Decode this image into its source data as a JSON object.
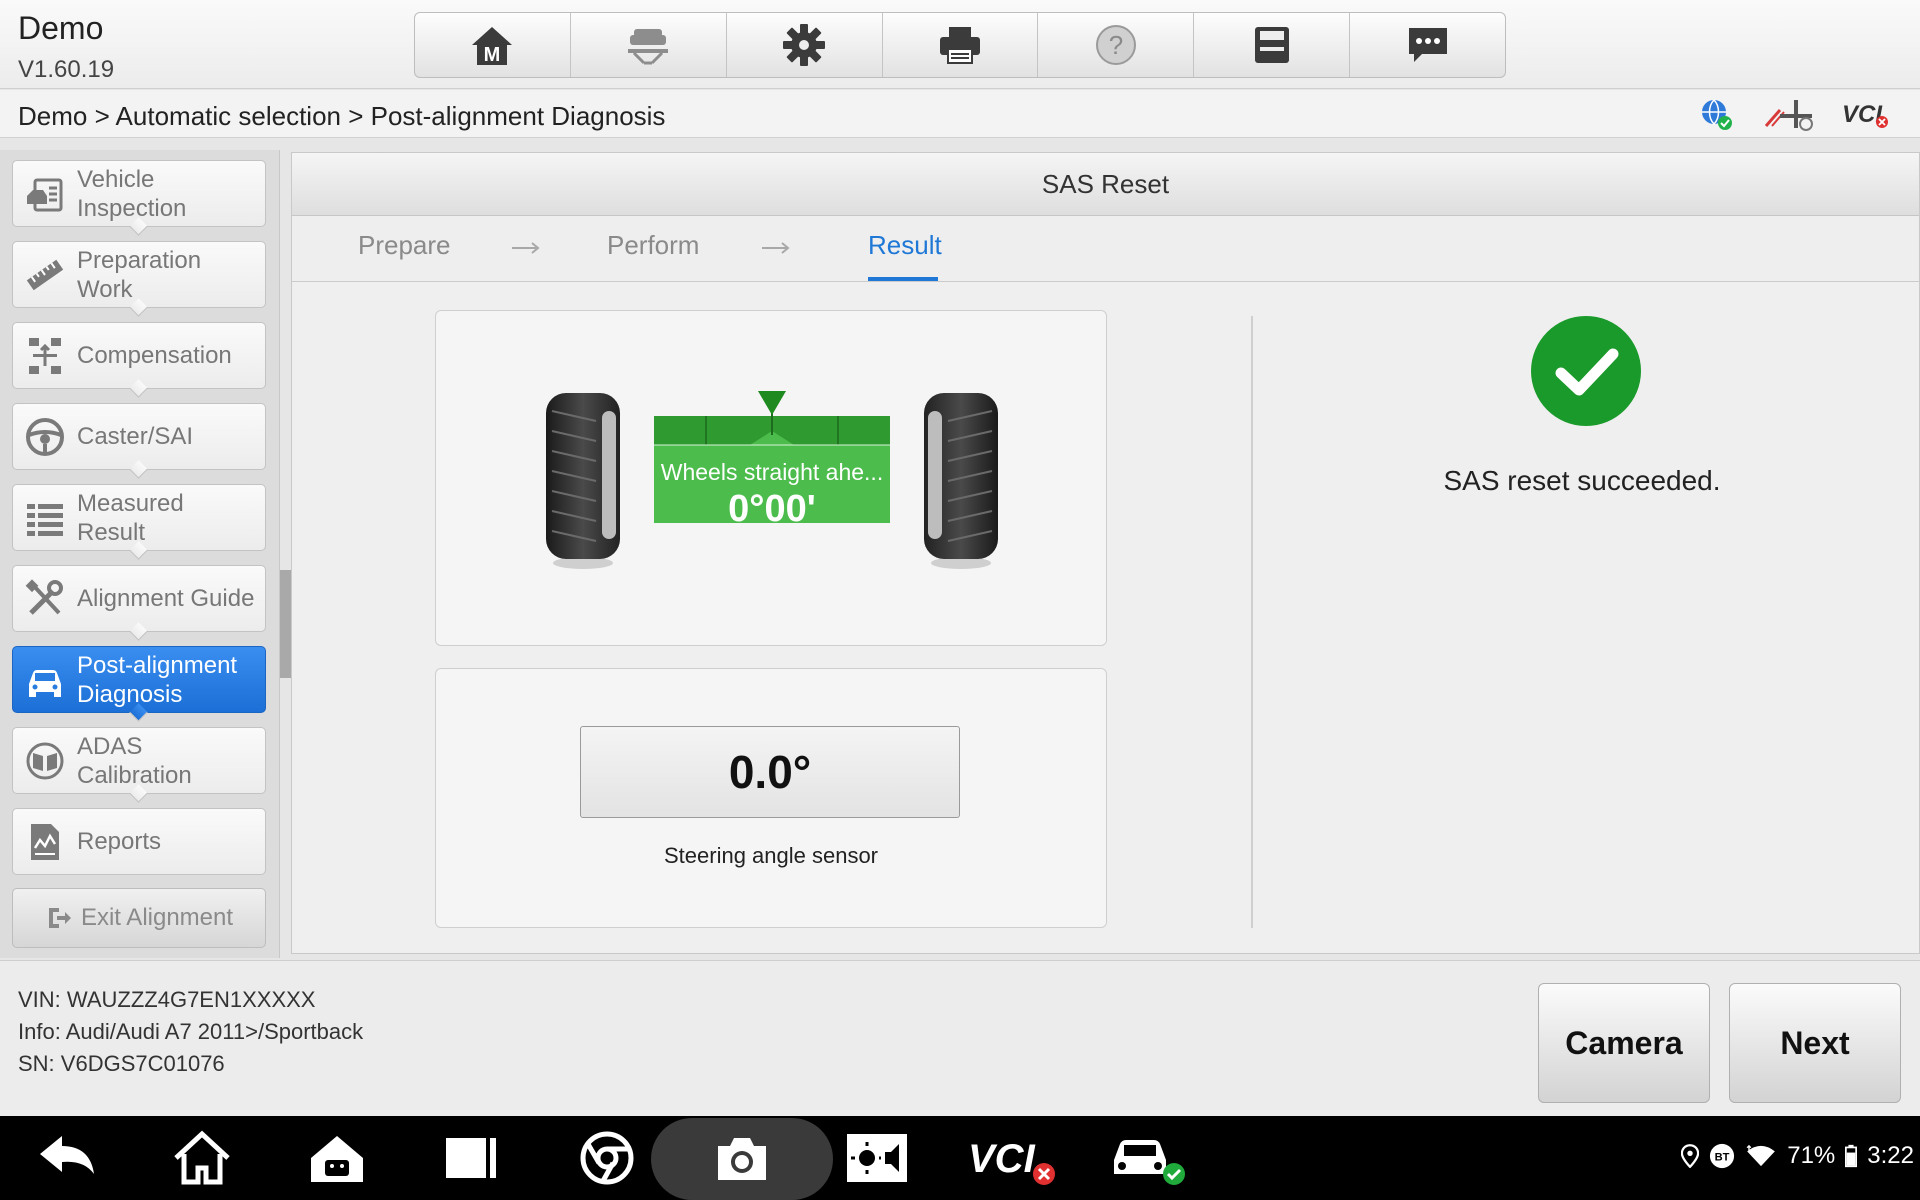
{
  "app": {
    "title": "Demo",
    "version": "V1.60.19"
  },
  "toolbar": {
    "buttons": [
      {
        "icon": "home-m-icon"
      },
      {
        "icon": "vehicle-lift-icon"
      },
      {
        "icon": "gear-icon"
      },
      {
        "icon": "printer-icon"
      },
      {
        "icon": "help-icon"
      },
      {
        "icon": "save-icon"
      },
      {
        "icon": "chat-icon"
      }
    ]
  },
  "breadcrumb": "Demo > Automatic selection > Post-alignment Diagnosis",
  "status": {
    "vci_label": "VCI"
  },
  "sidebar": {
    "items": [
      {
        "label": "Vehicle Inspection",
        "icon": "vehicle-inspection-icon",
        "active": false
      },
      {
        "label": "Preparation Work",
        "icon": "ruler-icon",
        "active": false
      },
      {
        "label": "Compensation",
        "icon": "compensation-icon",
        "active": false
      },
      {
        "label": "Caster/SAI",
        "icon": "steering-wheel-icon",
        "active": false
      },
      {
        "label": "Measured Result",
        "icon": "list-icon",
        "active": false
      },
      {
        "label": "Alignment Guide",
        "icon": "tools-icon",
        "active": false
      },
      {
        "label": "Post-alignment Diagnosis",
        "icon": "car-icon",
        "active": true
      },
      {
        "label": "ADAS Calibration",
        "icon": "adas-icon",
        "active": false
      },
      {
        "label": "Reports",
        "icon": "report-icon",
        "active": false
      }
    ],
    "exit_label": "Exit Alignment"
  },
  "panel": {
    "title": "SAS Reset",
    "steps": [
      {
        "label": "Prepare",
        "active": false
      },
      {
        "label": "Perform",
        "active": false
      },
      {
        "label": "Result",
        "active": true
      }
    ],
    "gauge": {
      "caption": "Wheels straight ahe...",
      "value": "0°00'"
    },
    "sensor": {
      "value": "0.0°",
      "label": "Steering angle sensor"
    },
    "result_message": "SAS reset succeeded."
  },
  "vehicle": {
    "vin": "VIN: WAUZZZ4G7EN1XXXXX",
    "info": "Info: Audi/Audi A7 2011>/Sportback",
    "sn": "SN: V6DGS7C01076"
  },
  "footer_buttons": {
    "camera": "Camera",
    "next": "Next"
  },
  "system": {
    "battery": "71%",
    "time": "3:22",
    "vci_label": "VCI"
  },
  "colors": {
    "accent": "#1f78d6",
    "success": "#1a9a2a",
    "gauge_green": "#4cbd4c"
  }
}
